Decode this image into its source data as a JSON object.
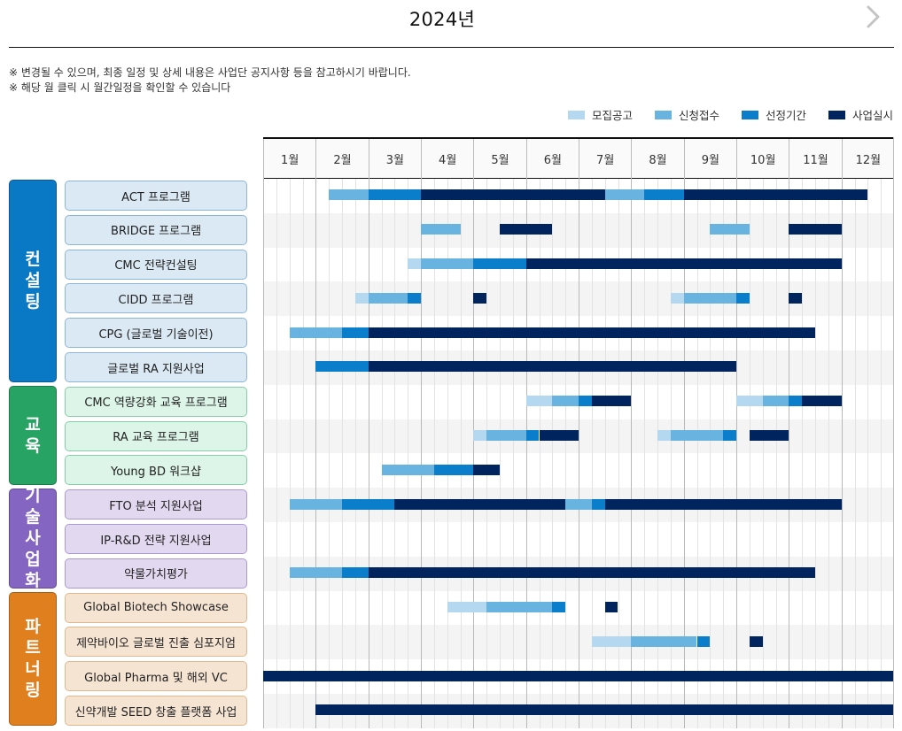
{
  "header": {
    "year_title": "2024년",
    "next_icon": "chevron-right-icon"
  },
  "notes": [
    "※ 변경될 수 있으며, 최종 일정 및 상세 내용은 사업단 공지사항 등을 참고하시기 바랍니다.",
    "※ 해당 월 클릭 시 월간일정을 확인할 수 있습니다"
  ],
  "legend": [
    {
      "key": "recruit",
      "label": "모집공고",
      "color": "#b5d8f1"
    },
    {
      "key": "apply",
      "label": "신청접수",
      "color": "#69b3e1"
    },
    {
      "key": "select",
      "label": "선정기간",
      "color": "#0a7ecb"
    },
    {
      "key": "run",
      "label": "사업실시",
      "color": "#00255e"
    }
  ],
  "months": [
    "1월",
    "2월",
    "3월",
    "4월",
    "5월",
    "6월",
    "7월",
    "8월",
    "9월",
    "10월",
    "11월",
    "12월"
  ],
  "weeks_per_month": 4,
  "categories": [
    {
      "label": "컨설팅",
      "chars": [
        "컨",
        "설",
        "팅"
      ],
      "color": "#0a79c5",
      "box_bg": "#dbe9f4",
      "box_border": "#8db6d6",
      "rows": 6
    },
    {
      "label": "교육",
      "chars": [
        "교",
        "육"
      ],
      "color": "#27a463",
      "box_bg": "#dcf5e8",
      "box_border": "#86cfa6",
      "rows": 3
    },
    {
      "label": "기술사업화",
      "chars": [
        "기",
        "술",
        "사",
        "업",
        "화"
      ],
      "color": "#8465c2",
      "box_bg": "#e2d9f0",
      "box_border": "#ad98d6",
      "rows": 3
    },
    {
      "label": "파트너링",
      "chars": [
        "파",
        "트",
        "너",
        "링"
      ],
      "color": "#e07f1d",
      "box_bg": "#f6e4d3",
      "box_border": "#dfb88d",
      "rows": 4
    }
  ],
  "programs": [
    {
      "name": "ACT 프로그램",
      "category": 0,
      "segments": [
        [
          "apply",
          5,
          8
        ],
        [
          "select",
          8,
          12
        ],
        [
          "run",
          12,
          26
        ],
        [
          "apply",
          26,
          29
        ],
        [
          "select",
          29,
          32
        ],
        [
          "run",
          32,
          46
        ]
      ]
    },
    {
      "name": "BRIDGE 프로그램",
      "category": 0,
      "segments": [
        [
          "apply",
          12,
          15
        ],
        [
          "run",
          18,
          22
        ],
        [
          "apply",
          34,
          37
        ],
        [
          "run",
          40,
          44
        ]
      ]
    },
    {
      "name": "CMC 전략컨설팅",
      "category": 0,
      "segments": [
        [
          "recruit",
          11,
          12
        ],
        [
          "apply",
          12,
          16
        ],
        [
          "select",
          16,
          20
        ],
        [
          "run",
          20,
          44
        ]
      ]
    },
    {
      "name": "CIDD 프로그램",
      "category": 0,
      "segments": [
        [
          "recruit",
          7,
          8
        ],
        [
          "apply",
          8,
          11
        ],
        [
          "select",
          11,
          12
        ],
        [
          "run",
          16,
          17
        ],
        [
          "recruit",
          31,
          32
        ],
        [
          "apply",
          32,
          36
        ],
        [
          "select",
          36,
          37
        ],
        [
          "run",
          40,
          41
        ]
      ]
    },
    {
      "name": "CPG (글로벌 기술이전)",
      "category": 0,
      "segments": [
        [
          "apply",
          2,
          6
        ],
        [
          "select",
          6,
          8
        ],
        [
          "run",
          8,
          42
        ]
      ]
    },
    {
      "name": "글로벌 RA 지원사업",
      "category": 0,
      "segments": [
        [
          "select",
          4,
          8
        ],
        [
          "run",
          8,
          36
        ]
      ]
    },
    {
      "name": "CMC 역량강화 교육 프로그램",
      "category": 1,
      "segments": [
        [
          "recruit",
          20,
          22
        ],
        [
          "apply",
          22,
          24
        ],
        [
          "select",
          24,
          25
        ],
        [
          "run",
          25,
          28
        ],
        [
          "recruit",
          36,
          38
        ],
        [
          "apply",
          38,
          40
        ],
        [
          "select",
          40,
          41
        ],
        [
          "run",
          41,
          44
        ]
      ]
    },
    {
      "name": "RA 교육 프로그램",
      "category": 1,
      "segments": [
        [
          "recruit",
          16,
          17
        ],
        [
          "apply",
          17,
          20
        ],
        [
          "select",
          20,
          21
        ],
        [
          "run",
          21,
          24
        ],
        [
          "recruit",
          30,
          31
        ],
        [
          "apply",
          31,
          35
        ],
        [
          "select",
          35,
          36
        ],
        [
          "run",
          37,
          40
        ]
      ]
    },
    {
      "name": "Young BD 워크샵",
      "category": 1,
      "segments": [
        [
          "apply",
          9,
          13
        ],
        [
          "select",
          13,
          16
        ],
        [
          "run",
          16,
          18
        ]
      ]
    },
    {
      "name": "FTO 분석 지원사업",
      "category": 2,
      "segments": [
        [
          "apply",
          2,
          6
        ],
        [
          "select",
          6,
          10
        ],
        [
          "run",
          10,
          23
        ],
        [
          "apply",
          23,
          25
        ],
        [
          "select",
          25,
          26
        ],
        [
          "run",
          26,
          44
        ]
      ]
    },
    {
      "name": "IP-R&D 전략 지원사업",
      "category": 2,
      "segments": []
    },
    {
      "name": "약물가치평가",
      "category": 2,
      "segments": [
        [
          "apply",
          2,
          6
        ],
        [
          "select",
          6,
          8
        ],
        [
          "run",
          8,
          42
        ]
      ]
    },
    {
      "name": "Global Biotech Showcase",
      "category": 3,
      "segments": [
        [
          "recruit",
          14,
          17
        ],
        [
          "apply",
          17,
          22
        ],
        [
          "select",
          22,
          23
        ],
        [
          "run",
          26,
          27
        ]
      ]
    },
    {
      "name": "제약바이오 글로벌 진출 심포지엄",
      "category": 3,
      "segments": [
        [
          "recruit",
          25,
          28
        ],
        [
          "apply",
          28,
          33
        ],
        [
          "select",
          33,
          34
        ],
        [
          "run",
          37,
          38
        ]
      ]
    },
    {
      "name": "Global Pharma 및 해외 VC",
      "category": 3,
      "segments": [
        [
          "run",
          0,
          48
        ]
      ]
    },
    {
      "name": "신약개발 SEED 창출 플랫폼 사업",
      "category": 3,
      "segments": [
        [
          "run",
          4,
          48
        ]
      ]
    }
  ]
}
